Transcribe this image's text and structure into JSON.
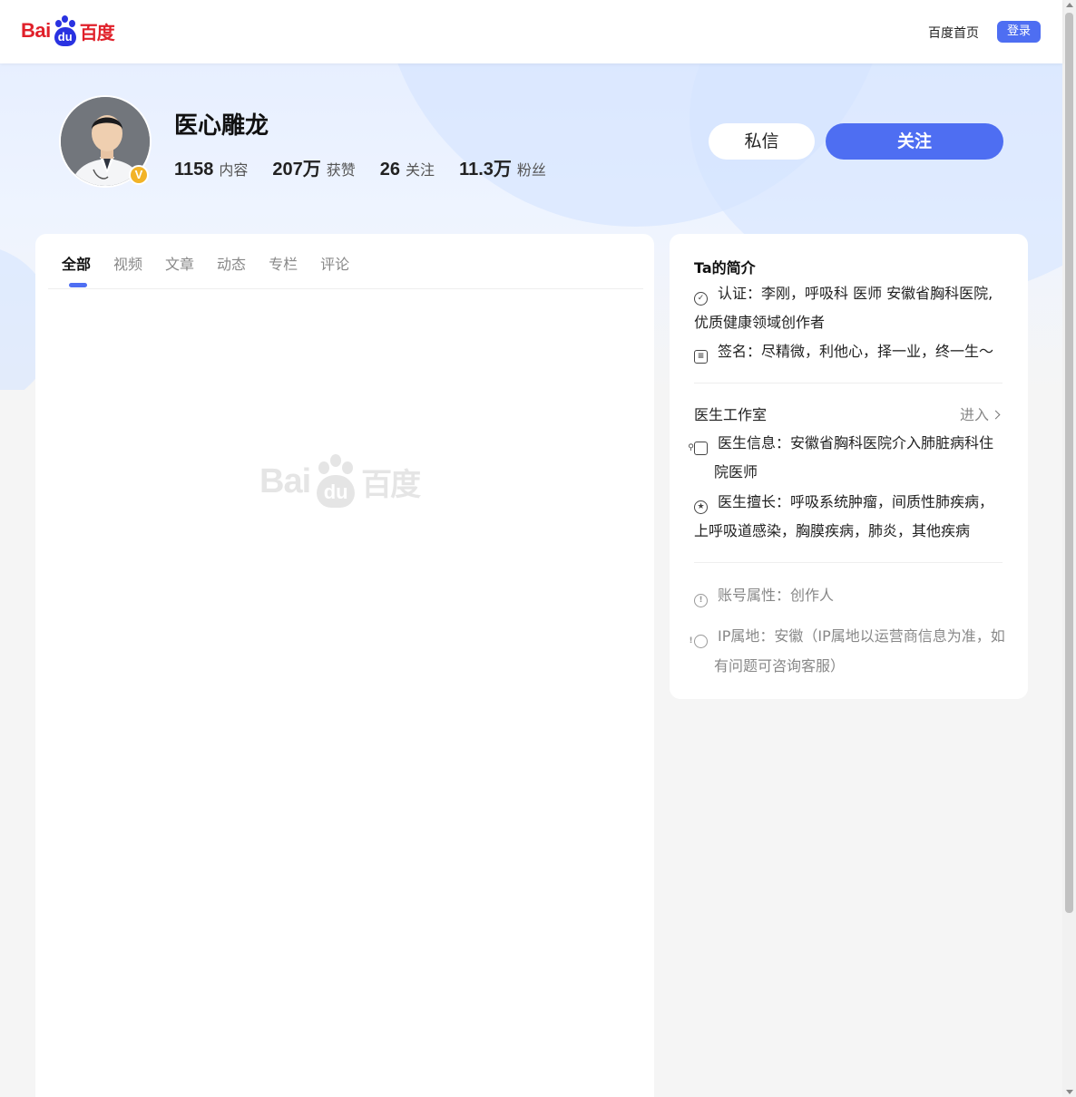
{
  "header": {
    "logo_text_latin": "Bai",
    "logo_text_du": "du",
    "logo_text_cn": "百度",
    "home_link": "百度首页",
    "login_button": "登录"
  },
  "profile": {
    "name": "医心雕龙",
    "verified_mark": "V",
    "stats": [
      {
        "value": "1158",
        "label": "内容"
      },
      {
        "value": "207万",
        "label": "获赞"
      },
      {
        "value": "26",
        "label": "关注"
      },
      {
        "value": "11.3万",
        "label": "粉丝"
      }
    ],
    "message_button": "私信",
    "follow_button": "关注"
  },
  "tabs": [
    "全部",
    "视频",
    "文章",
    "动态",
    "专栏",
    "评论"
  ],
  "active_tab": "全部",
  "placeholder": {
    "latin": "Bai",
    "du": "du",
    "cn": "百度"
  },
  "intro": {
    "title": "Ta的简介",
    "certification": "认证：李刚，呼吸科 医师 安徽省胸科医院,优质健康领域创作者",
    "signature": "签名：尽精微，利他心，择一业，终一生～",
    "studio_title": "医生工作室",
    "studio_enter": "进入",
    "doctor_info": "医生信息：安徽省胸科医院介入肺脏病科住院医师",
    "doctor_specialty": "医生擅长：呼吸系统肿瘤，间质性肺疾病，上呼吸道感染，胸膜疾病，肺炎，其他疾病",
    "account_attr": "账号属性：创作人",
    "ip_location": "IP属地：安徽（IP属地以运营商信息为准，如有问题可咨询客服）"
  },
  "colors": {
    "accent": "#4e6ef2",
    "logo_red": "#e0202a",
    "logo_blue": "#2932e1",
    "badge_gold": "#f2b327"
  }
}
